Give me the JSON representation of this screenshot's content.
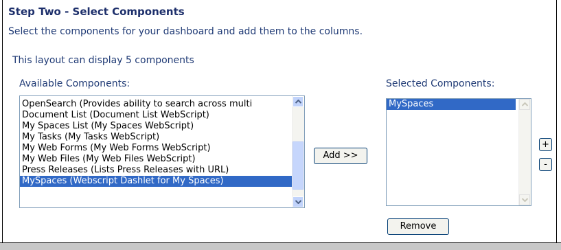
{
  "header": {
    "title": "Step Two - Select Components",
    "intro": "Select the components for your dashboard and add them to the columns.",
    "layout_info": "This layout can display 5 components"
  },
  "available": {
    "label": "Available Components:",
    "items": [
      "OpenSearch (Provides ability to search across multi",
      "Document List (Document List WebScript)",
      "My Spaces List (My Spaces WebScript)",
      "My Tasks (My Tasks WebScript)",
      "My Web Forms (My Web Forms WebScript)",
      "My Web Files (My Web Files WebScript)",
      "Press Releases (Lists Press Releases with URL)",
      "MySpaces (Webscript Dashlet for My Spaces)"
    ],
    "selected_item": "MySpaces (Webscript Dashlet for My Spaces)"
  },
  "selected": {
    "label": "Selected Components:",
    "items": [
      "MySpaces"
    ]
  },
  "buttons": {
    "add": "Add >>",
    "plus": "+",
    "minus": "-",
    "remove": "Remove"
  },
  "colors": {
    "text": "#1f3a75",
    "selection": "#3169c6",
    "scrollbar": "#c1d3fb"
  },
  "icons": [
    "scroll-up-arrow-icon",
    "scroll-down-arrow-icon"
  ]
}
